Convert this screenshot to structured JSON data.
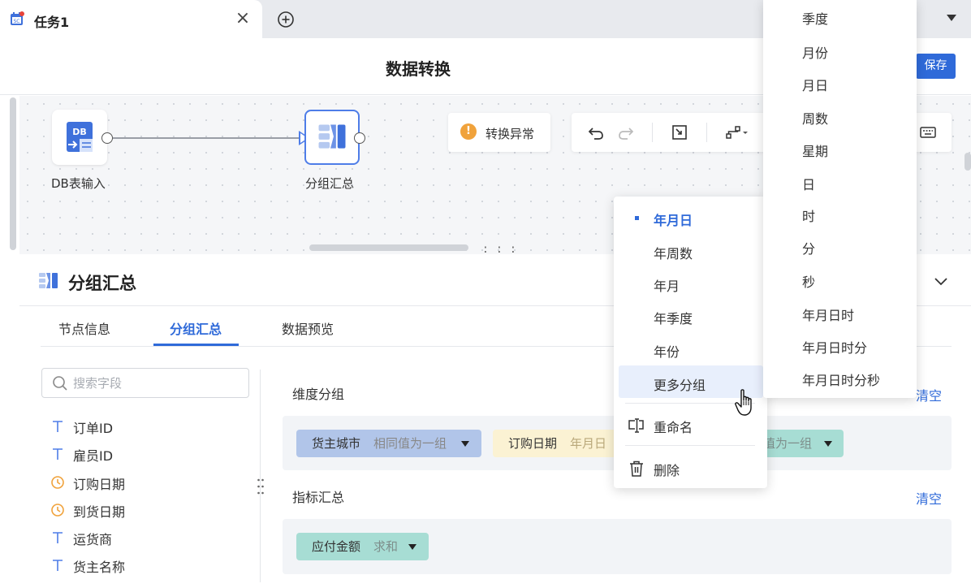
{
  "tabbar": {
    "tab_label": "任务1",
    "close_glyph": "×",
    "icons": {
      "tab": "calendar-task-icon",
      "close": "close-icon",
      "add": "add-tab-icon",
      "menu": "caret-down-icon"
    }
  },
  "header": {
    "title": "数据转换",
    "save_label": "保存"
  },
  "canvas": {
    "nodes": [
      {
        "label": "DB表输入",
        "icon_text": "DB",
        "icon": "db-input-icon"
      },
      {
        "label": "分组汇总",
        "icon": "group-summary-icon"
      }
    ],
    "error_chip": {
      "icon": "warning-icon",
      "glyph": "!",
      "label": "转换异常"
    },
    "toolbar_icons": [
      "undo-icon",
      "redo-icon",
      "fit-view-icon",
      "layout-icon",
      "keyboard-icon"
    ]
  },
  "panel": {
    "title": "分组汇总",
    "tabs": [
      {
        "label": "节点信息",
        "active": false
      },
      {
        "label": "分组汇总",
        "active": true
      },
      {
        "label": "数据预览",
        "active": false
      }
    ],
    "search": {
      "placeholder": "搜索字段",
      "value": ""
    },
    "fields": [
      {
        "name": "订单ID",
        "type": "text"
      },
      {
        "name": "雇员ID",
        "type": "text"
      },
      {
        "name": "订购日期",
        "type": "date"
      },
      {
        "name": "到货日期",
        "type": "date"
      },
      {
        "name": "运货商",
        "type": "text"
      },
      {
        "name": "货主名称",
        "type": "text"
      }
    ],
    "dimension": {
      "label": "维度分组",
      "clear_label": "清空",
      "chips": [
        {
          "name": "货主城市",
          "agg": "相同值为一组",
          "color": "#b1c5e9"
        },
        {
          "name": "订购日期",
          "agg": "年月日",
          "color": "#fbf2d3"
        },
        {
          "name": "",
          "agg": "值为一组",
          "color": "#a7ddd4"
        }
      ]
    },
    "metric": {
      "label": "指标汇总",
      "clear_label": "清空",
      "chips": [
        {
          "name": "应付金额",
          "agg": "求和",
          "color": "#a7ddd4"
        }
      ]
    }
  },
  "context_menu": {
    "items": [
      {
        "label": "年月日",
        "selected": true
      },
      {
        "label": "年周数"
      },
      {
        "label": "年月"
      },
      {
        "label": "年季度"
      },
      {
        "label": "年份"
      },
      {
        "label": "更多分组",
        "hover": true
      }
    ],
    "actions": [
      {
        "label": "重命名",
        "icon": "rename-icon"
      },
      {
        "label": "删除",
        "icon": "trash-icon"
      }
    ]
  },
  "sub_menu": {
    "items": [
      "季度",
      "月份",
      "月日",
      "周数",
      "星期",
      "日",
      "时",
      "分",
      "秒",
      "年月日时",
      "年月日时分",
      "年月日时分秒"
    ]
  },
  "colors": {
    "accent": "#2f6ad9",
    "warning": "#f0a23b",
    "date_icon": "#f0a23b"
  }
}
